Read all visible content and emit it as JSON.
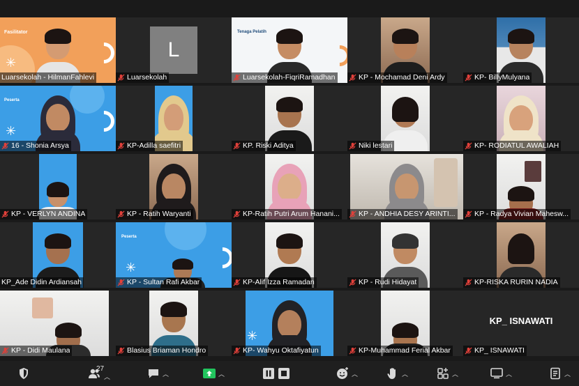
{
  "participants": [
    {
      "name": "Luarsekolah - HilmanFahlevi",
      "active": true
    },
    {
      "name": "Luarsekolah",
      "avatar_letter": "L"
    },
    {
      "name": "Luarsekolah-FiqriRamadhan"
    },
    {
      "name": "KP - Mochamad Deni Ardy"
    },
    {
      "name": "KP- BillyMulyana"
    },
    {
      "name": "16 - Shonia Arsya"
    },
    {
      "name": "KP-Adilla saefitri"
    },
    {
      "name": "KP. Riski Aditya"
    },
    {
      "name": "Niki lestari"
    },
    {
      "name": "KP- RODIATUL AWALIAH"
    },
    {
      "name": "KP - VERLYN ANDINA"
    },
    {
      "name": "KP - Ratih Waryanti"
    },
    {
      "name": "KP-Ratih Putri Arum Hanani..."
    },
    {
      "name": "KP - ANDHIA DESY ARINTI..."
    },
    {
      "name": "KP - Radya Vivian Mahesw..."
    },
    {
      "name": "KP_Ade Didin Ardiansah"
    },
    {
      "name": "KP - Sultan Rafi Akbar"
    },
    {
      "name": "KP-Alif Izza Ramadan"
    },
    {
      "name": "KP - Rudi Hidayat"
    },
    {
      "name": "KP-RISKA RURIN NADIA"
    },
    {
      "name": "KP - Didi Maulana"
    },
    {
      "name": "Blasius Briaman Hondro"
    },
    {
      "name": "KP- Wahyu Oktafiyatun"
    },
    {
      "name": "KP-Muhammad Ferial Akbar"
    },
    {
      "name": "KP_ ISNAWATI",
      "video_off_name": "KP_ ISNAWATI"
    }
  ],
  "slides": {
    "facilitator_label": "Fasilitator",
    "tenaga_label": "Tenaga Pelatih",
    "peserta_label": "Peserta"
  },
  "toolbar": {
    "participants_count": "27",
    "share_color": "#22c55e"
  },
  "colors": {
    "active_outline": "#e8d63a",
    "muted_mic": "#e0403a",
    "slide_blue": "#3c9ee6",
    "slide_orange": "#f2a05a"
  }
}
